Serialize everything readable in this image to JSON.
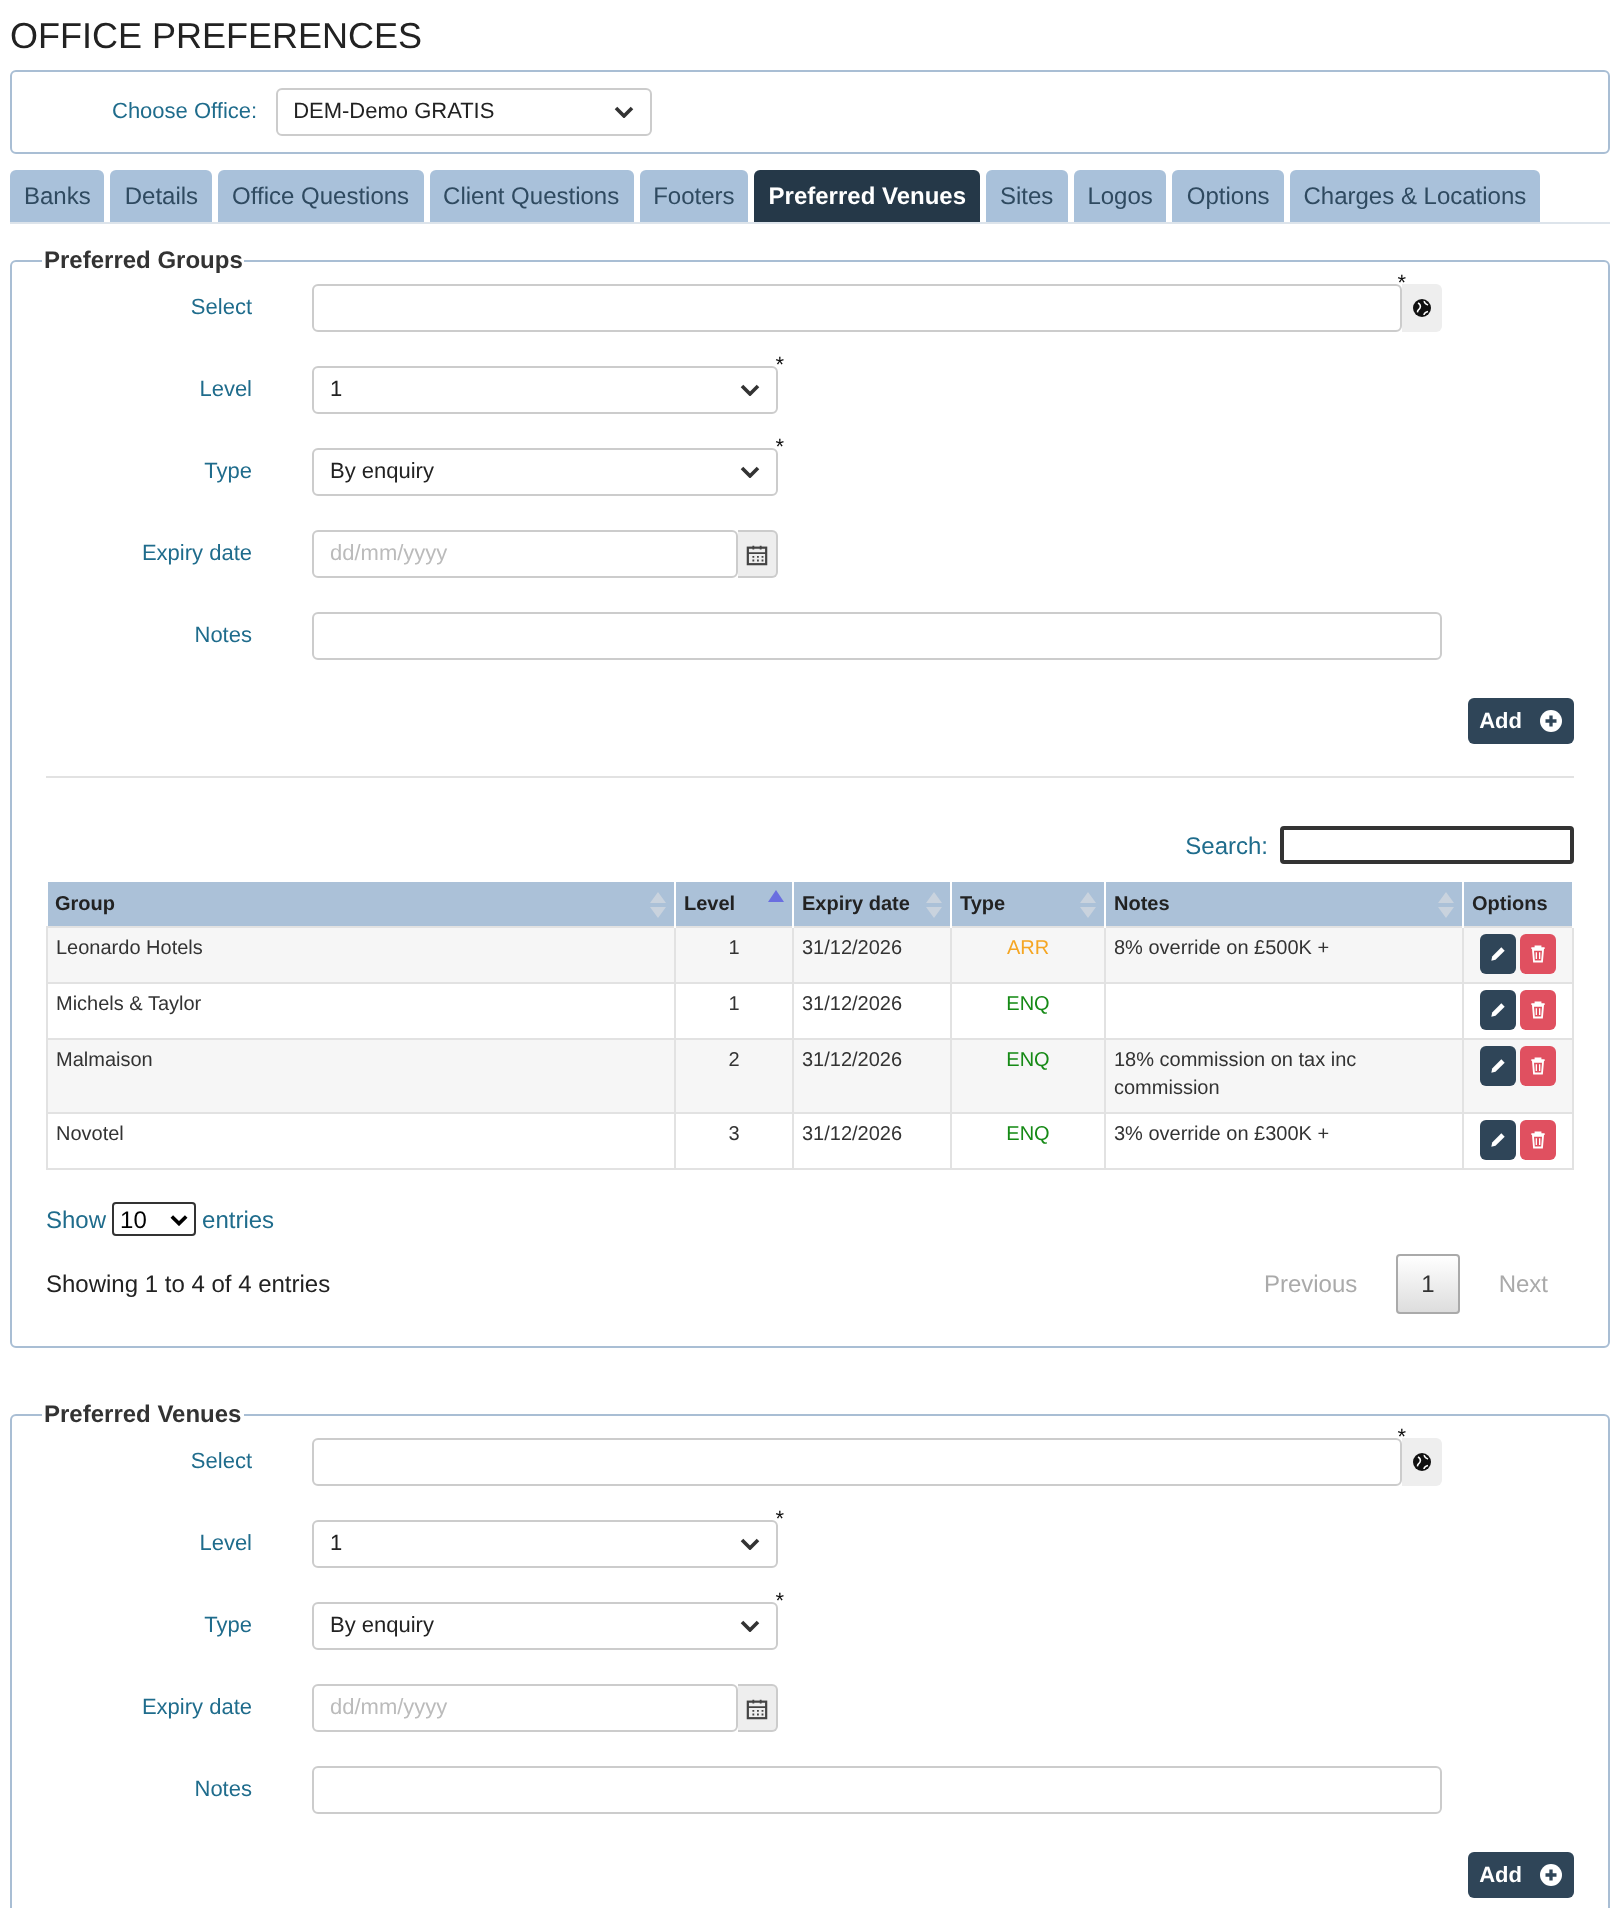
{
  "page_title": "OFFICE PREFERENCES",
  "office": {
    "label": "Choose Office:",
    "value": "DEM-Demo GRATIS"
  },
  "tabs": [
    {
      "label": "Banks",
      "selected": false
    },
    {
      "label": "Details",
      "selected": false
    },
    {
      "label": "Office Questions",
      "selected": false
    },
    {
      "label": "Client Questions",
      "selected": false
    },
    {
      "label": "Footers",
      "selected": false
    },
    {
      "label": "Preferred Venues",
      "selected": true
    },
    {
      "label": "Sites",
      "selected": false
    },
    {
      "label": "Logos",
      "selected": false
    },
    {
      "label": "Options",
      "selected": false
    },
    {
      "label": "Charges & Locations",
      "selected": false
    }
  ],
  "sections": [
    {
      "legend": "Preferred Groups",
      "fields": [
        {
          "label": "Select",
          "kind": "lookup",
          "required_mark": "*"
        },
        {
          "label": "Level",
          "kind": "dropdown",
          "value": "1",
          "required_mark": "*"
        },
        {
          "label": "Type",
          "kind": "dropdown",
          "value": "By enquiry",
          "required_mark": "*"
        },
        {
          "label": "Expiry date",
          "kind": "date",
          "placeholder": "dd/mm/yyyy"
        },
        {
          "label": "Notes",
          "kind": "text"
        }
      ],
      "add_button": "Add",
      "table": {
        "search_label": "Search:",
        "columns": [
          {
            "label": "Group",
            "sortable": true,
            "sorted": false
          },
          {
            "label": "Level",
            "sortable": true,
            "sorted": true
          },
          {
            "label": "Expiry date",
            "sortable": true,
            "sorted": false
          },
          {
            "label": "Type",
            "sortable": true,
            "sorted": false
          },
          {
            "label": "Notes",
            "sortable": true,
            "sorted": false
          },
          {
            "label": "Options"
          }
        ],
        "rows": [
          {
            "group": "Leonardo Hotels",
            "level": "1",
            "expiry": "31/12/2026",
            "type": "ARR",
            "color": "#f5a623",
            "notes": "8% override on £500K +"
          },
          {
            "group": "Michels & Taylor",
            "level": "1",
            "expiry": "31/12/2026",
            "type": "ENQ",
            "color": "#168a16"
          },
          {
            "group": "Malmaison",
            "level": "2",
            "expiry": "31/12/2026",
            "type": "ENQ",
            "color": "#168a16",
            "notes": "18% commission on tax inc commission"
          },
          {
            "group": "Novotel",
            "level": "3",
            "expiry": "31/12/2026",
            "type": "ENQ",
            "color": "#168a16",
            "notes": "3% override on £300K +"
          }
        ],
        "show_label": "Show",
        "page_size": "10",
        "entries_label": "entries",
        "info": "Showing 1 to 4 of 4 entries",
        "pager": [
          {
            "label": "Previous",
            "kind": "nav",
            "disabled": true
          },
          {
            "label": "1",
            "kind": "page",
            "selected": true
          },
          {
            "label": "Next",
            "kind": "nav",
            "disabled": true
          }
        ]
      }
    },
    {
      "legend": "Preferred Venues",
      "fields": [
        {
          "label": "Select",
          "kind": "lookup",
          "required_mark": "*"
        },
        {
          "label": "Level",
          "kind": "dropdown",
          "value": "1",
          "required_mark": "*"
        },
        {
          "label": "Type",
          "kind": "dropdown",
          "value": "By enquiry",
          "required_mark": "*"
        },
        {
          "label": "Expiry date",
          "kind": "date",
          "placeholder": "dd/mm/yyyy"
        },
        {
          "label": "Notes",
          "kind": "text"
        }
      ],
      "add_button": "Add"
    }
  ]
}
